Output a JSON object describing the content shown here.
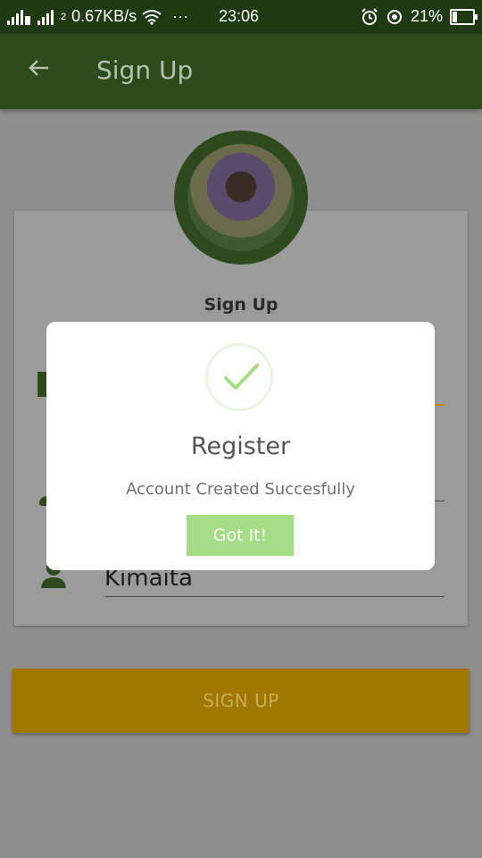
{
  "status_bar": {
    "sim2_label": "2",
    "speed": "0.67KB/s",
    "more": "···",
    "time": "23:06",
    "battery": "21%"
  },
  "app_bar": {
    "title": "Sign Up"
  },
  "form": {
    "title": "Sign Up",
    "last_name_value": "Kimaita",
    "submit_label": "SIGN UP"
  },
  "dialog": {
    "title": "Register",
    "message": "Account Created Succesfully",
    "button_label": "Got It!"
  },
  "colors": {
    "status_bar": "#1f3a12",
    "app_bar": "#2d4a1a",
    "accent_green": "#2c4a1c",
    "submit_button": "#a07700",
    "dialog_button": "#a5dc86"
  },
  "icons": [
    "signal-icon",
    "wifi-icon",
    "alarm-icon",
    "location-icon",
    "battery-icon",
    "back-arrow-icon",
    "email-icon",
    "person-icon",
    "check-icon"
  ]
}
